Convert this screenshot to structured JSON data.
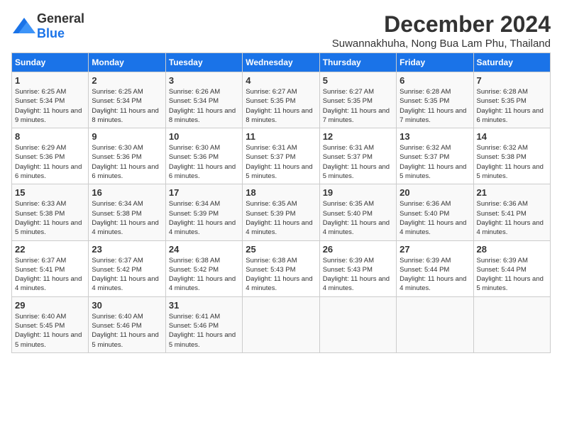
{
  "logo": {
    "general": "General",
    "blue": "Blue"
  },
  "title": "December 2024",
  "subtitle": "Suwannakhuha, Nong Bua Lam Phu, Thailand",
  "weekdays": [
    "Sunday",
    "Monday",
    "Tuesday",
    "Wednesday",
    "Thursday",
    "Friday",
    "Saturday"
  ],
  "weeks": [
    [
      {
        "day": "1",
        "sunrise": "6:25 AM",
        "sunset": "5:34 PM",
        "daylight": "11 hours and 9 minutes."
      },
      {
        "day": "2",
        "sunrise": "6:25 AM",
        "sunset": "5:34 PM",
        "daylight": "11 hours and 8 minutes."
      },
      {
        "day": "3",
        "sunrise": "6:26 AM",
        "sunset": "5:34 PM",
        "daylight": "11 hours and 8 minutes."
      },
      {
        "day": "4",
        "sunrise": "6:27 AM",
        "sunset": "5:35 PM",
        "daylight": "11 hours and 8 minutes."
      },
      {
        "day": "5",
        "sunrise": "6:27 AM",
        "sunset": "5:35 PM",
        "daylight": "11 hours and 7 minutes."
      },
      {
        "day": "6",
        "sunrise": "6:28 AM",
        "sunset": "5:35 PM",
        "daylight": "11 hours and 7 minutes."
      },
      {
        "day": "7",
        "sunrise": "6:28 AM",
        "sunset": "5:35 PM",
        "daylight": "11 hours and 6 minutes."
      }
    ],
    [
      {
        "day": "8",
        "sunrise": "6:29 AM",
        "sunset": "5:36 PM",
        "daylight": "11 hours and 6 minutes."
      },
      {
        "day": "9",
        "sunrise": "6:30 AM",
        "sunset": "5:36 PM",
        "daylight": "11 hours and 6 minutes."
      },
      {
        "day": "10",
        "sunrise": "6:30 AM",
        "sunset": "5:36 PM",
        "daylight": "11 hours and 6 minutes."
      },
      {
        "day": "11",
        "sunrise": "6:31 AM",
        "sunset": "5:37 PM",
        "daylight": "11 hours and 5 minutes."
      },
      {
        "day": "12",
        "sunrise": "6:31 AM",
        "sunset": "5:37 PM",
        "daylight": "11 hours and 5 minutes."
      },
      {
        "day": "13",
        "sunrise": "6:32 AM",
        "sunset": "5:37 PM",
        "daylight": "11 hours and 5 minutes."
      },
      {
        "day": "14",
        "sunrise": "6:32 AM",
        "sunset": "5:38 PM",
        "daylight": "11 hours and 5 minutes."
      }
    ],
    [
      {
        "day": "15",
        "sunrise": "6:33 AM",
        "sunset": "5:38 PM",
        "daylight": "11 hours and 5 minutes."
      },
      {
        "day": "16",
        "sunrise": "6:34 AM",
        "sunset": "5:38 PM",
        "daylight": "11 hours and 4 minutes."
      },
      {
        "day": "17",
        "sunrise": "6:34 AM",
        "sunset": "5:39 PM",
        "daylight": "11 hours and 4 minutes."
      },
      {
        "day": "18",
        "sunrise": "6:35 AM",
        "sunset": "5:39 PM",
        "daylight": "11 hours and 4 minutes."
      },
      {
        "day": "19",
        "sunrise": "6:35 AM",
        "sunset": "5:40 PM",
        "daylight": "11 hours and 4 minutes."
      },
      {
        "day": "20",
        "sunrise": "6:36 AM",
        "sunset": "5:40 PM",
        "daylight": "11 hours and 4 minutes."
      },
      {
        "day": "21",
        "sunrise": "6:36 AM",
        "sunset": "5:41 PM",
        "daylight": "11 hours and 4 minutes."
      }
    ],
    [
      {
        "day": "22",
        "sunrise": "6:37 AM",
        "sunset": "5:41 PM",
        "daylight": "11 hours and 4 minutes."
      },
      {
        "day": "23",
        "sunrise": "6:37 AM",
        "sunset": "5:42 PM",
        "daylight": "11 hours and 4 minutes."
      },
      {
        "day": "24",
        "sunrise": "6:38 AM",
        "sunset": "5:42 PM",
        "daylight": "11 hours and 4 minutes."
      },
      {
        "day": "25",
        "sunrise": "6:38 AM",
        "sunset": "5:43 PM",
        "daylight": "11 hours and 4 minutes."
      },
      {
        "day": "26",
        "sunrise": "6:39 AM",
        "sunset": "5:43 PM",
        "daylight": "11 hours and 4 minutes."
      },
      {
        "day": "27",
        "sunrise": "6:39 AM",
        "sunset": "5:44 PM",
        "daylight": "11 hours and 4 minutes."
      },
      {
        "day": "28",
        "sunrise": "6:39 AM",
        "sunset": "5:44 PM",
        "daylight": "11 hours and 5 minutes."
      }
    ],
    [
      {
        "day": "29",
        "sunrise": "6:40 AM",
        "sunset": "5:45 PM",
        "daylight": "11 hours and 5 minutes."
      },
      {
        "day": "30",
        "sunrise": "6:40 AM",
        "sunset": "5:46 PM",
        "daylight": "11 hours and 5 minutes."
      },
      {
        "day": "31",
        "sunrise": "6:41 AM",
        "sunset": "5:46 PM",
        "daylight": "11 hours and 5 minutes."
      },
      null,
      null,
      null,
      null
    ]
  ]
}
